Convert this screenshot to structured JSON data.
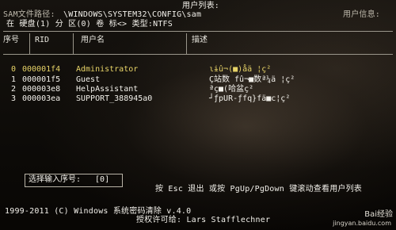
{
  "header": {
    "title": "用户列表:",
    "sam_path_label": "SAM文件路径:",
    "sam_path": "\\WINDOWS\\SYSTEM32\\CONFIG\\sam",
    "disk_info": "在  硬盘(1)  分 区(0) 卷 标<> 类型:NTFS",
    "user_info_label": "用户信息:"
  },
  "table": {
    "headers": [
      "序号",
      "RID",
      "用户名",
      "描述"
    ],
    "rows": [
      {
        "index": "0",
        "rid": "000001f4",
        "name": "Administrator",
        "desc": "ɩɨû¬(■)åä ¦ç²"
      },
      {
        "index": "1",
        "rid": "000001f5",
        "name": "Guest",
        "desc": "Ç站数 fû¬■数ª¼ä ¦ç²"
      },
      {
        "index": "2",
        "rid": "000003e8",
        "name": "HelpAssistant",
        "desc": "ªç■(哈盆ç²"
      },
      {
        "index": "3",
        "rid": "000003ea",
        "name": "SUPPORT_388945a0",
        "desc": "┘ƒpUR-ƒfq}fä■c¦ç²"
      }
    ]
  },
  "prompt": {
    "label": "选择输入序号:",
    "value": "0"
  },
  "footer": {
    "hint": "按 Esc 退出  或按 PgUp/PgDown 键滚动查看用户列表",
    "copyright": "1999-2011 (C)  Windows 系统密码清除 v.4.0",
    "license": "授权许可给:  Lars Stafflechner"
  },
  "watermark": {
    "site": "jingyan.baidu.com",
    "badge": "Bai经验"
  }
}
